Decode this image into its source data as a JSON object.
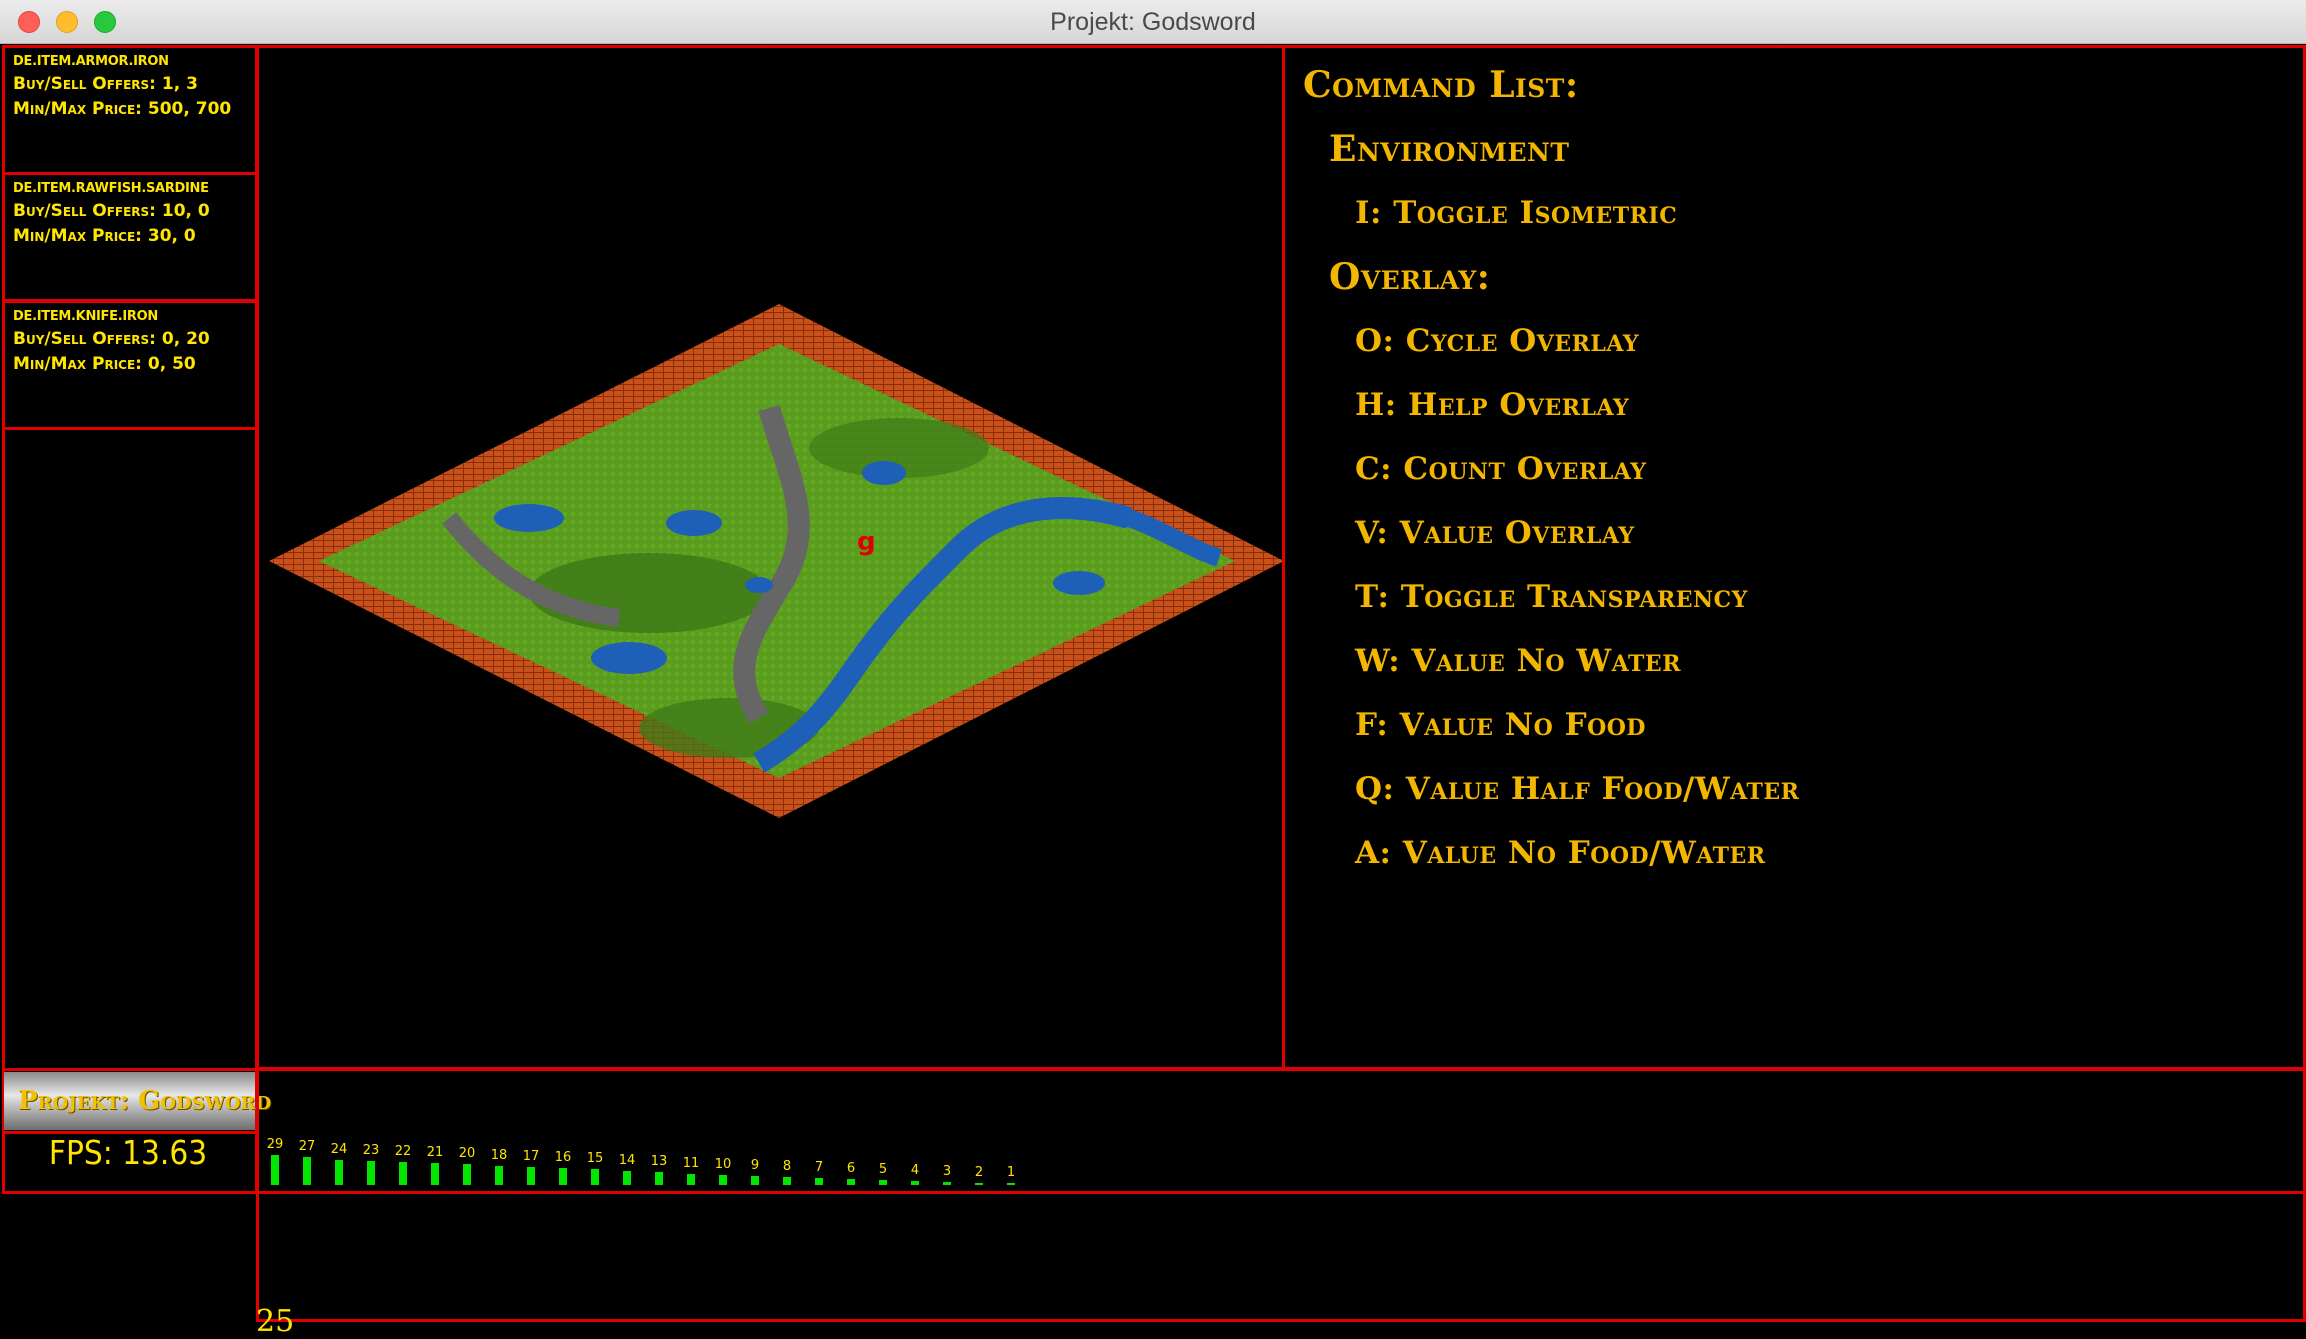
{
  "window": {
    "title": "Projekt: Godsword"
  },
  "market": [
    {
      "item": "DE.ITEM.ARMOR.IRON",
      "offers": "Buy/Sell Offers: 1, 3",
      "price": "Min/Max Price: 500, 700"
    },
    {
      "item": "DE.ITEM.RAWFISH.SARDINE",
      "offers": "Buy/Sell Offers: 10, 0",
      "price": "Min/Max Price: 30, 0"
    },
    {
      "item": "DE.ITEM.KNIFE.IRON",
      "offers": "Buy/Sell Offers: 0, 20",
      "price": "Min/Max Price: 0, 50"
    }
  ],
  "commands": {
    "title": "Command List:",
    "environment": "Environment",
    "toggle_iso": "I: Toggle Isometric",
    "overlay": "Overlay:",
    "items": [
      "O: Cycle Overlay",
      "H: Help Overlay",
      "C: Count Overlay",
      "V: Value Overlay",
      "T: Toggle Transparency",
      "W: Value No Water",
      "F: Value No Food",
      "Q: Value Half Food/Water",
      "A: Value No Food/Water"
    ]
  },
  "logo": {
    "text": "Projekt: Godsword"
  },
  "fps": {
    "label": "FPS: 13.63"
  },
  "histogram": {
    "labels": [
      "29",
      "27",
      "24",
      "23",
      "22",
      "21",
      "20",
      "18",
      "17",
      "16",
      "15",
      "14",
      "13",
      "11",
      "10",
      "9",
      "8",
      "7",
      "6",
      "5",
      "4",
      "3",
      "2",
      "1"
    ],
    "values": [
      29,
      27,
      24,
      23,
      22,
      21,
      20,
      18,
      17,
      16,
      15,
      14,
      13,
      11,
      10,
      9,
      8,
      7,
      6,
      5,
      4,
      3,
      2,
      1
    ],
    "color": "#00e600"
  },
  "corner": {
    "text": "25"
  },
  "colors": {
    "frame": "#e00000",
    "text": "#ffe600",
    "command": "#f2b600"
  }
}
